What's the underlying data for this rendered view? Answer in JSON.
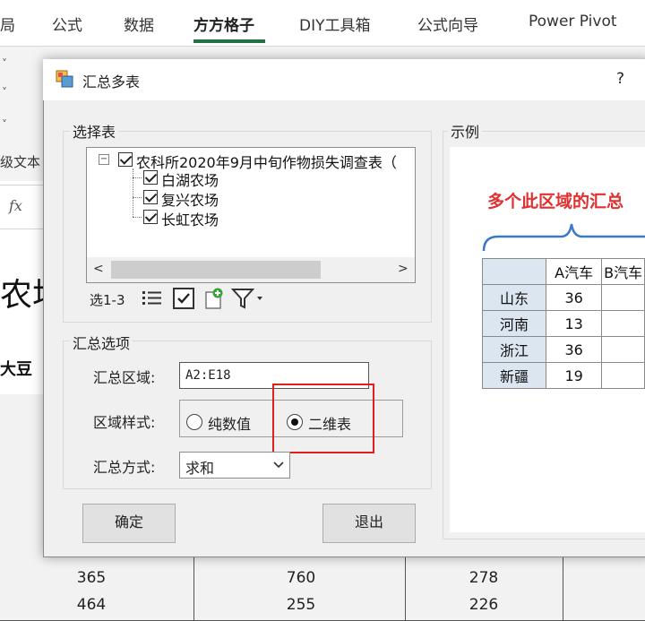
{
  "ribbon": {
    "tabs": [
      "局",
      "公式",
      "数据",
      "方方格子",
      "DIY工具箱",
      "公式向导",
      "Power Pivot"
    ],
    "active_tab": "方方格子",
    "group_label": "级文本",
    "accent_color": "#217346"
  },
  "formula_bar": {
    "fx_label": "fx"
  },
  "sheet": {
    "big_cell_text": "农场",
    "label_cell_text": "大豆",
    "rows": [
      {
        "a": "365",
        "b": "760",
        "c": "278"
      },
      {
        "a": "464",
        "b": "255",
        "c": "226"
      }
    ]
  },
  "dialog": {
    "title": "汇总多表",
    "help": "?",
    "select_group": {
      "label": "选择表",
      "root": "农科所2020年9月中旬作物损失调查表（",
      "children": [
        "白湖农场",
        "复兴农场",
        "长虹农场"
      ],
      "selection_label": "选1-3",
      "scroll_left": "<",
      "scroll_right": ">"
    },
    "options_group": {
      "label": "汇总选项",
      "range_label": "汇总区域:",
      "range_value": "A2:E18",
      "style_label": "区域样式:",
      "style_options": [
        "纯数值",
        "二维表"
      ],
      "style_selected": "二维表",
      "method_label": "汇总方式:",
      "method_value": "求和"
    },
    "buttons": {
      "ok": "确定",
      "exit": "退出"
    },
    "example": {
      "label": "示例",
      "title": "多个此区域的汇总",
      "table": {
        "headers": [
          "A汽车",
          "B汽车"
        ],
        "rows": [
          {
            "name": "山东",
            "value": "36"
          },
          {
            "name": "河南",
            "value": "13"
          },
          {
            "name": "浙江",
            "value": "36"
          },
          {
            "name": "新疆",
            "value": "19"
          }
        ]
      },
      "title_color": "#e03030",
      "brace_color": "#3a78c8"
    },
    "highlight_color": "#e02020"
  }
}
